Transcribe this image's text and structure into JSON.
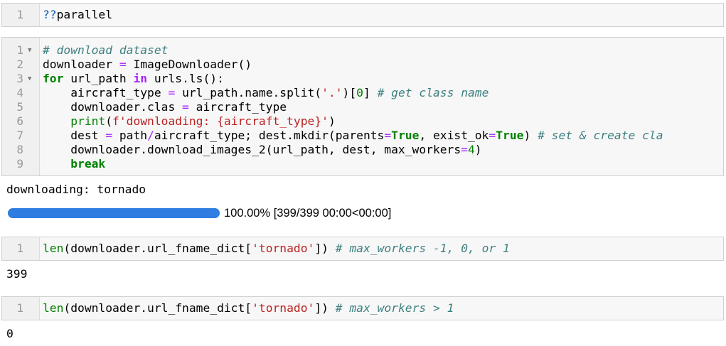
{
  "cells": [
    {
      "id": "cell1",
      "lines": [
        {
          "n": "1",
          "fold": false,
          "tokens": [
            {
              "t": "??",
              "c": "qm"
            },
            {
              "t": "parallel",
              "c": ""
            }
          ]
        }
      ]
    },
    {
      "id": "cell2",
      "lines": [
        {
          "n": "1",
          "fold": true,
          "tokens": [
            {
              "t": "# download dataset",
              "c": "c"
            }
          ]
        },
        {
          "n": "2",
          "fold": false,
          "tokens": [
            {
              "t": "downloader ",
              "c": ""
            },
            {
              "t": "=",
              "c": "o"
            },
            {
              "t": " ImageDownloader()",
              "c": ""
            }
          ]
        },
        {
          "n": "3",
          "fold": true,
          "tokens": [
            {
              "t": "for",
              "c": "k"
            },
            {
              "t": " url_path ",
              "c": ""
            },
            {
              "t": "in",
              "c": "ow"
            },
            {
              "t": " urls.ls():",
              "c": ""
            }
          ]
        },
        {
          "n": "4",
          "fold": false,
          "tokens": [
            {
              "t": "    aircraft_type ",
              "c": ""
            },
            {
              "t": "=",
              "c": "o"
            },
            {
              "t": " url_path.name.split(",
              "c": ""
            },
            {
              "t": "'.'",
              "c": "s"
            },
            {
              "t": ")[",
              "c": ""
            },
            {
              "t": "0",
              "c": "m"
            },
            {
              "t": "] ",
              "c": ""
            },
            {
              "t": "# get class name",
              "c": "c"
            }
          ]
        },
        {
          "n": "5",
          "fold": false,
          "tokens": [
            {
              "t": "    downloader.clas ",
              "c": ""
            },
            {
              "t": "=",
              "c": "o"
            },
            {
              "t": " aircraft_type",
              "c": ""
            }
          ]
        },
        {
          "n": "6",
          "fold": false,
          "tokens": [
            {
              "t": "    ",
              "c": ""
            },
            {
              "t": "print",
              "c": "n"
            },
            {
              "t": "(",
              "c": ""
            },
            {
              "t": "f'downloading: ",
              "c": "s"
            },
            {
              "t": "{aircraft_type}",
              "c": "s"
            },
            {
              "t": "'",
              "c": "s"
            },
            {
              "t": ")",
              "c": ""
            }
          ]
        },
        {
          "n": "7",
          "fold": false,
          "tokens": [
            {
              "t": "    dest ",
              "c": ""
            },
            {
              "t": "=",
              "c": "o"
            },
            {
              "t": " path",
              "c": ""
            },
            {
              "t": "/",
              "c": "o"
            },
            {
              "t": "aircraft_type; dest.mkdir(parents",
              "c": ""
            },
            {
              "t": "=",
              "c": "o"
            },
            {
              "t": "True",
              "c": "kc"
            },
            {
              "t": ", exist_ok",
              "c": ""
            },
            {
              "t": "=",
              "c": "o"
            },
            {
              "t": "True",
              "c": "kc"
            },
            {
              "t": ") ",
              "c": ""
            },
            {
              "t": "# set & create cla",
              "c": "c"
            }
          ]
        },
        {
          "n": "8",
          "fold": false,
          "tokens": [
            {
              "t": "    downloader.download_images_2(url_path, dest, max_workers",
              "c": ""
            },
            {
              "t": "=",
              "c": "o"
            },
            {
              "t": "4",
              "c": "m"
            },
            {
              "t": ")",
              "c": ""
            }
          ]
        },
        {
          "n": "9",
          "fold": false,
          "tokens": [
            {
              "t": "    ",
              "c": ""
            },
            {
              "t": "break",
              "c": "k"
            }
          ]
        }
      ]
    },
    {
      "id": "cell3",
      "lines": [
        {
          "n": "1",
          "fold": false,
          "tokens": [
            {
              "t": "len",
              "c": "n"
            },
            {
              "t": "(downloader.url_fname_dict[",
              "c": ""
            },
            {
              "t": "'tornado'",
              "c": "s"
            },
            {
              "t": "]) ",
              "c": ""
            },
            {
              "t": "# max_workers -1, 0, or 1",
              "c": "c"
            }
          ]
        }
      ]
    },
    {
      "id": "cell4",
      "lines": [
        {
          "n": "1",
          "fold": false,
          "tokens": [
            {
              "t": "len",
              "c": "n"
            },
            {
              "t": "(downloader.url_fname_dict[",
              "c": ""
            },
            {
              "t": "'tornado'",
              "c": "s"
            },
            {
              "t": "]) ",
              "c": ""
            },
            {
              "t": "# max_workers > 1",
              "c": "c"
            }
          ]
        }
      ]
    }
  ],
  "outputs": {
    "download_msg": "downloading: tornado",
    "progress_fraction": 1.0,
    "progress_text": "100.00% [399/399 00:00<00:00]",
    "result3": "399",
    "result4": "0"
  }
}
